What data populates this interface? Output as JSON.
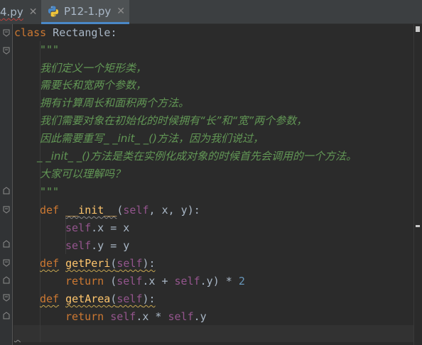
{
  "tabs": [
    {
      "label": "4.py",
      "active": false
    },
    {
      "label": "P12-1.py",
      "active": true
    }
  ],
  "close_glyph": "✕",
  "colors": {
    "background": "#2b2b2b",
    "keyword": "#cc7832",
    "function": "#ffc66d",
    "self": "#94558d",
    "number": "#6897bb",
    "docstring": "#629755",
    "text": "#a9b7c6",
    "active_tab_underline": "#4a88c7"
  },
  "code": {
    "l1": {
      "kw": "class",
      "rest": " Rectangle:"
    },
    "l2": {
      "doc": "\"\"\""
    },
    "l3": {
      "doc": "我们定义一个矩形类，"
    },
    "l4": {
      "doc": "需要长和宽两个参数，"
    },
    "l5": {
      "doc": "拥有计算周长和面积两个方法。"
    },
    "l6": {
      "doc": "我们需要对象在初始化的时候拥有“长”和“宽”两个参数，"
    },
    "l7": {
      "doc": "因此需要重写_ _init_ _()方法，因为我们说过，"
    },
    "l8": {
      "doc": "_ _init_ _()方法是类在实例化成对象的时候首先会调用的一个方法。"
    },
    "l9": {
      "doc": "大家可以理解吗？"
    },
    "l10": {
      "doc": "\"\"\""
    },
    "l11": {
      "kw": "def",
      "fn": "__init__",
      "open": "(",
      "self": "self",
      "params": ", x, y):"
    },
    "l12": {
      "self": "self",
      "rest": ".x = x"
    },
    "l13": {
      "self": "self",
      "rest": ".y = y"
    },
    "l14": {
      "kw": "def",
      "fn": "getPeri",
      "open": "(",
      "self": "self",
      "close": "):"
    },
    "l15": {
      "kw": "return",
      "open": " (",
      "self1": "self",
      "mid": ".x + ",
      "self2": "self",
      "tail": ".y) * ",
      "num": "2"
    },
    "l16": {
      "kw": "def",
      "fn": "getArea",
      "open": "(",
      "self": "self",
      "close": "):"
    },
    "l17": {
      "kw": "return",
      "sp": " ",
      "self1": "self",
      "mid": ".x * ",
      "self2": "self",
      "tail": ".y"
    }
  }
}
